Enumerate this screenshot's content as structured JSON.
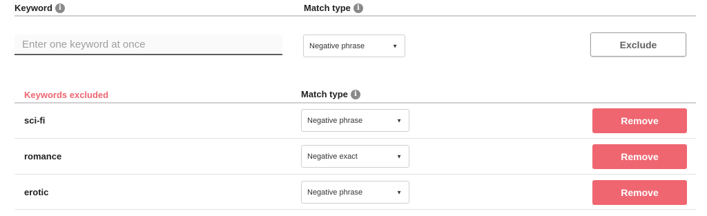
{
  "header": {
    "keyword_label": "Keyword",
    "match_type_label": "Match type"
  },
  "add_form": {
    "keyword_placeholder": "Enter one keyword at once",
    "keyword_value": "",
    "match_type_selected": "Negative phrase",
    "exclude_label": "Exclude"
  },
  "excluded": {
    "title": "Keywords excluded",
    "match_type_label": "Match type",
    "remove_label": "Remove",
    "rows": [
      {
        "keyword": "sci-fi",
        "match_type": "Negative phrase"
      },
      {
        "keyword": "romance",
        "match_type": "Negative exact"
      },
      {
        "keyword": "erotic",
        "match_type": "Negative phrase"
      }
    ]
  },
  "icons": {
    "info": "info-icon",
    "dropdown": "chevron-down-icon"
  },
  "colors": {
    "accent": "#ef6670",
    "text": "#212121",
    "muted": "#9e9e9e"
  }
}
